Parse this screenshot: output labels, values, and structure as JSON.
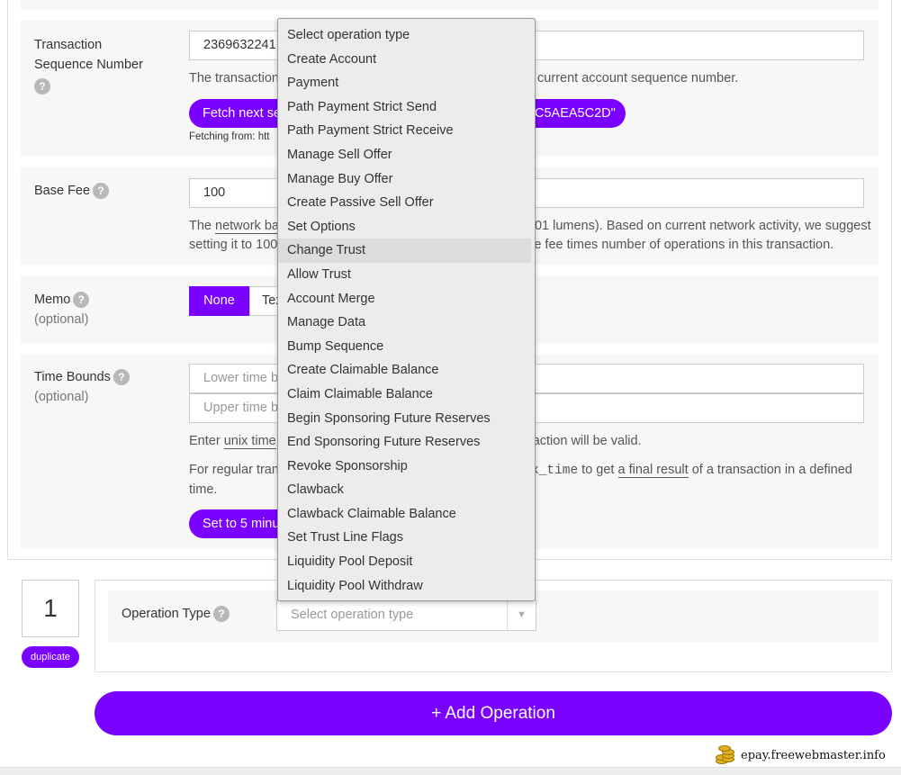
{
  "sequence": {
    "label_line1": "Transaction",
    "label_line2": "Sequence Number",
    "value": "2369632241",
    "help_text_left": "The transaction",
    "help_text_right": "n current account sequence number.",
    "fetch_button_left": "Fetch next se",
    "fetch_button_right": "C5AEA5C2D\"",
    "fetching_from": "Fetching from: htt"
  },
  "base_fee": {
    "label": "Base Fee",
    "value": "100",
    "help_text_1a": "The ",
    "help_text_1_link": "network ba",
    "help_text_1b": "01 lumens). Based on current network activity, we suggest",
    "help_text_2a": "setting it to 100",
    "help_text_2b": "e fee times number of operations in this transaction."
  },
  "memo": {
    "label": "Memo",
    "sublabel": "(optional)",
    "tab_none": "None",
    "tab_text": "Tex"
  },
  "time_bounds": {
    "label": "Time Bounds",
    "sublabel": "(optional)",
    "lower_placeholder": "Lower time b",
    "upper_placeholder": "Upper time b",
    "help_1a": "Enter ",
    "help_1_link": "unix time",
    "help_1b": "action will be valid.",
    "help_2a": "For regular tran",
    "help_2_code": "x_time",
    "help_2b": " to get ",
    "help_2_link": "a final result",
    "help_2c": " of a transaction in a defined",
    "help_3": "time.",
    "set_button": "Set to 5 minu"
  },
  "operation": {
    "number": "1",
    "duplicate_label": "duplicate",
    "type_label": "Operation Type",
    "select_placeholder": "Select operation type",
    "select_arrow": "▼"
  },
  "dropdown": {
    "options": [
      "Select operation type",
      "Create Account",
      "Payment",
      "Path Payment Strict Send",
      "Path Payment Strict Receive",
      "Manage Sell Offer",
      "Manage Buy Offer",
      "Create Passive Sell Offer",
      "Set Options",
      "Change Trust",
      "Allow Trust",
      "Account Merge",
      "Manage Data",
      "Bump Sequence",
      "Create Claimable Balance",
      "Claim Claimable Balance",
      "Begin Sponsoring Future Reserves",
      "End Sponsoring Future Reserves",
      "Revoke Sponsorship",
      "Clawback",
      "Clawback Claimable Balance",
      "Set Trust Line Flags",
      "Liquidity Pool Deposit",
      "Liquidity Pool Withdraw"
    ],
    "highlighted_index": 9
  },
  "add_operation": "+ Add Operation",
  "watermark": "epay.freewebmaster.info",
  "help_glyph": "?",
  "colors": {
    "accent": "#7a00ff",
    "row_bg": "#f7f7f7"
  }
}
